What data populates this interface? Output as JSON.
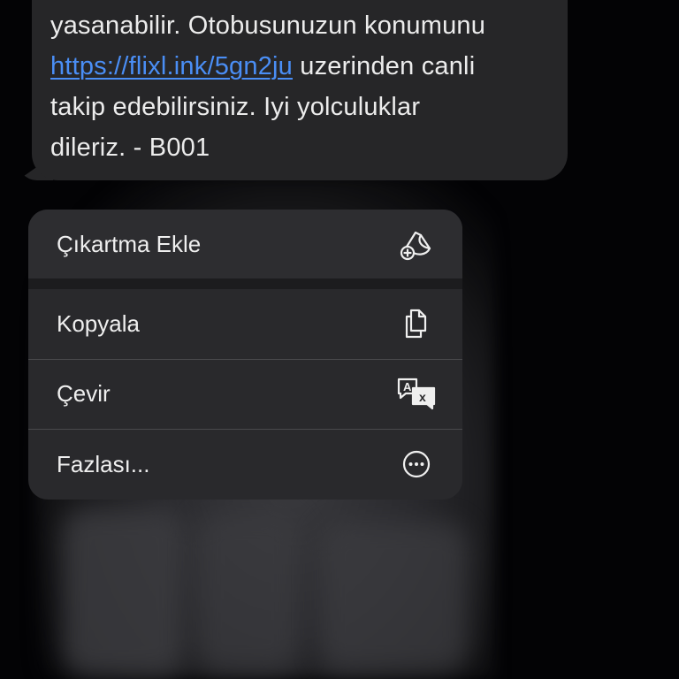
{
  "message": {
    "lines": [
      "yasanabilir. Otobusunuzun konumunu",
      "uzerinden canli",
      "takip edebilirsiniz. Iyi yolculuklar",
      "dileriz. - B001"
    ],
    "link_text": "https://flixl.ink/5gn2ju",
    "link_color": "#4a8ef5"
  },
  "menu": {
    "items": [
      {
        "label": "Çıkartma Ekle",
        "icon": "sticker-add-icon"
      },
      {
        "label": "Kopyala",
        "icon": "copy-icon"
      },
      {
        "label": "Çevir",
        "icon": "translate-icon"
      },
      {
        "label": "Fazlası...",
        "icon": "more-ellipsis-icon"
      }
    ]
  }
}
